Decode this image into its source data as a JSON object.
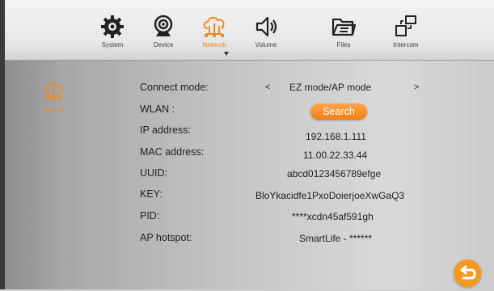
{
  "tabs": [
    {
      "label": "System",
      "icon": "gear-icon"
    },
    {
      "label": "Device",
      "icon": "camera-icon"
    },
    {
      "label": "Network",
      "icon": "cloud-network-icon",
      "active": true
    },
    {
      "label": "Volume",
      "icon": "speaker-icon"
    },
    {
      "label": "Files",
      "icon": "folder-icon"
    },
    {
      "label": "Intercom",
      "icon": "intercom-icon"
    }
  ],
  "sidebar": {
    "label": "Network",
    "icon": "cloud-network-icon"
  },
  "connect_mode": {
    "label": "Connect mode:",
    "value": "EZ mode/AP mode",
    "prev": "<",
    "next": ">"
  },
  "wlan": {
    "label": "WLAN :",
    "button": "Search"
  },
  "ip": {
    "label": "IP address:",
    "value": "192.168.1.111"
  },
  "mac": {
    "label": "MAC address:",
    "value": "11.00.22.33.44"
  },
  "uuid": {
    "label": "UUID:",
    "value": "abcd0123456789efge"
  },
  "key": {
    "label": "KEY:",
    "value": "BloYkacidfe1PxoDoierjoeXwGaQ3"
  },
  "pid": {
    "label": "PID:",
    "value": "****xcdn45af591gh"
  },
  "hotspot": {
    "label": "AP hotspot:",
    "value": "SmartLife - ******"
  },
  "colors": {
    "accent": "#f08a1c"
  }
}
